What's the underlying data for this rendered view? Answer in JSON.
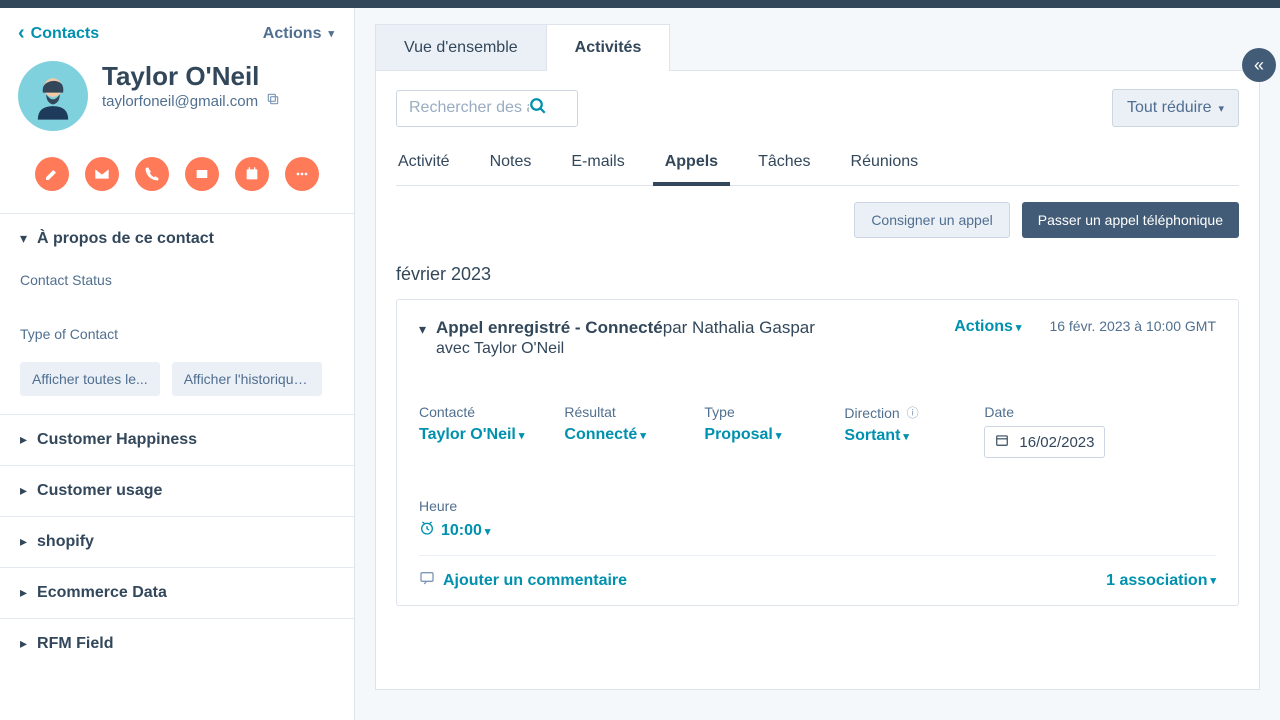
{
  "sidebar": {
    "back": "Contacts",
    "actions": "Actions",
    "name": "Taylor O'Neil",
    "email": "taylorfoneil@gmail.com",
    "about_title": "À propos de ce contact",
    "field_status": "Contact Status",
    "field_type": "Type of Contact",
    "btn_show_all": "Afficher toutes le...",
    "btn_history": "Afficher l'historique d...",
    "sections": [
      "Customer Happiness",
      "Customer usage",
      "shopify",
      "Ecommerce Data",
      "RFM Field"
    ]
  },
  "main": {
    "tab_overview": "Vue d'ensemble",
    "tab_activities": "Activités",
    "search_placeholder": "Rechercher des a",
    "collapse_all": "Tout réduire",
    "subtabs": [
      "Activité",
      "Notes",
      "E-mails",
      "Appels",
      "Tâches",
      "Réunions"
    ],
    "active_subtab": "Appels",
    "log_call": "Consigner un appel",
    "make_call": "Passer un appel téléphonique",
    "month": "février 2023",
    "card": {
      "title_prefix": "Appel enregistré - Connecté",
      "by": "par Nathalia Gaspar",
      "with": "avec Taylor O'Neil",
      "actions": "Actions",
      "timestamp": "16 févr. 2023 à 10:00 GMT",
      "props": {
        "contacted_label": "Contacté",
        "contacted_val": "Taylor O'Neil",
        "result_label": "Résultat",
        "result_val": "Connecté",
        "type_label": "Type",
        "type_val": "Proposal",
        "direction_label": "Direction",
        "direction_val": "Sortant",
        "date_label": "Date",
        "date_val": "16/02/2023",
        "time_label": "Heure",
        "time_val": "10:00"
      },
      "add_comment": "Ajouter un commentaire",
      "association": "1 association"
    }
  }
}
